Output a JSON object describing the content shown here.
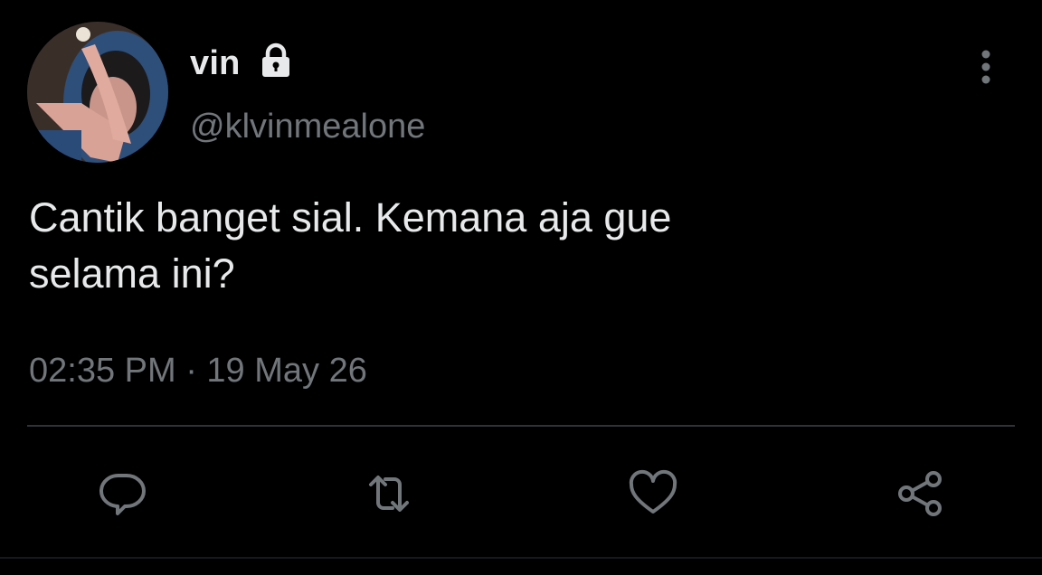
{
  "user": {
    "display_name": "vin",
    "handle": "@klvinmealone",
    "protected_icon": "lock-icon",
    "avatar_icon": "avatar-photo"
  },
  "tweet": {
    "text": "Cantik banget sial. Kemana aja gue\nselama ini?",
    "timestamp": "02:35 PM · 19 May 26"
  },
  "actions": {
    "more": "more-vertical-icon",
    "reply": "reply-icon",
    "retweet": "retweet-icon",
    "like": "heart-icon",
    "share": "share-icon"
  },
  "colors": {
    "background": "#000000",
    "text_primary": "#e7e9ea",
    "text_secondary": "#71767b",
    "divider": "#2f3336"
  }
}
